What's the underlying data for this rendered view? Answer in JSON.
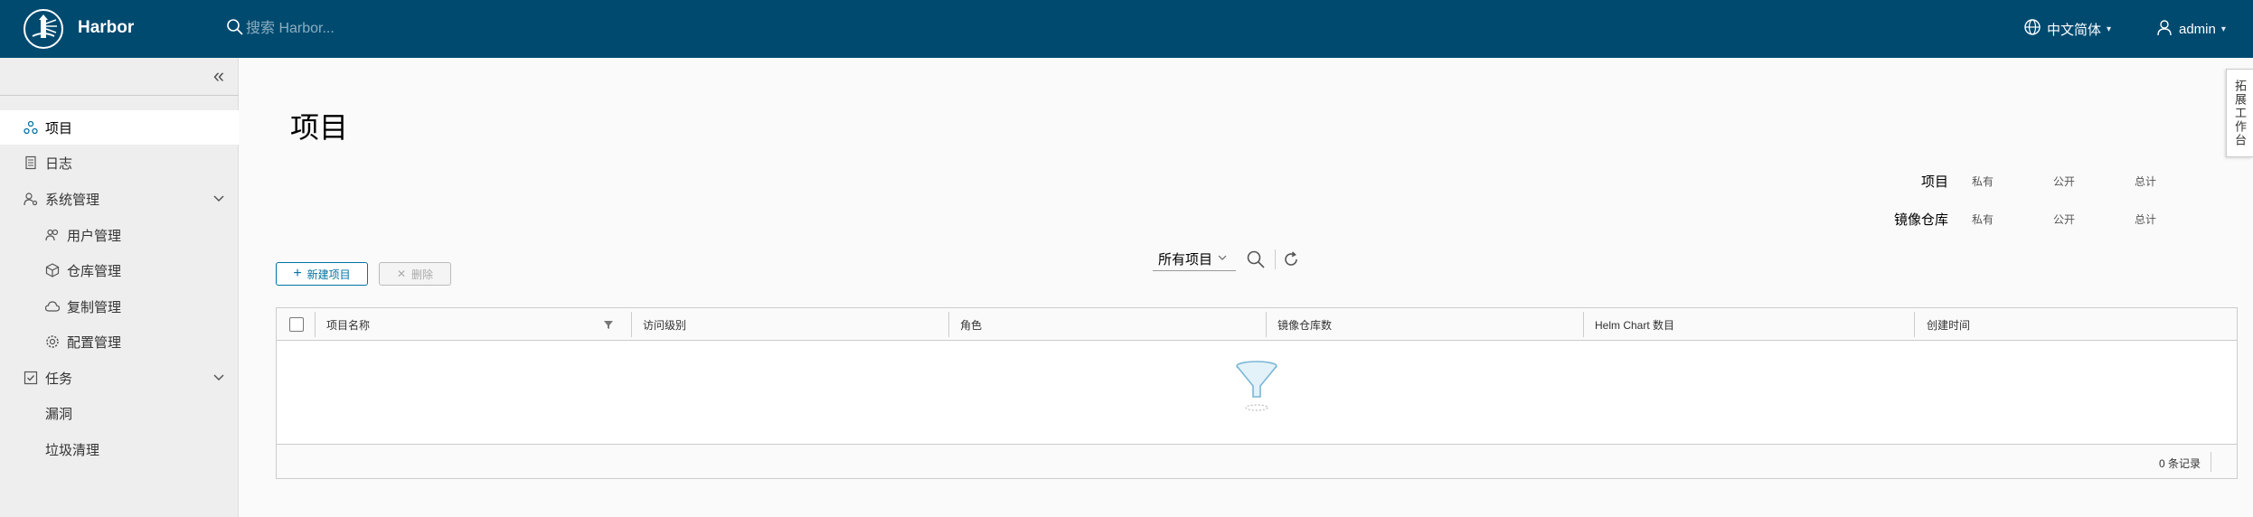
{
  "header": {
    "app_title": "Harbor",
    "search_placeholder": "搜索 Harbor...",
    "language": "中文简体",
    "user": "admin"
  },
  "sidebar": {
    "items": [
      {
        "label": "项目",
        "icon": "projects-icon",
        "active": true
      },
      {
        "label": "日志",
        "icon": "logs-icon"
      },
      {
        "label": "系统管理",
        "icon": "admin-icon",
        "expandable": true
      },
      {
        "label": "用户管理",
        "icon": "users-icon"
      },
      {
        "label": "仓库管理",
        "icon": "registry-icon"
      },
      {
        "label": "复制管理",
        "icon": "cloud-icon"
      },
      {
        "label": "配置管理",
        "icon": "gear-icon"
      },
      {
        "label": "任务",
        "icon": "tasks-icon",
        "expandable": true
      },
      {
        "label": "漏洞"
      },
      {
        "label": "垃圾清理"
      }
    ]
  },
  "main": {
    "title": "项目",
    "stats": {
      "projects_label": "项目",
      "repos_label": "镜像仓库",
      "private": "私有",
      "public": "公开",
      "total": "总计"
    },
    "toolbar": {
      "new_label": "新建项目",
      "delete_label": "删除",
      "filter_value": "所有项目"
    },
    "table": {
      "columns": [
        "项目名称",
        "访问级别",
        "角色",
        "镜像仓库数",
        "Helm Chart 数目",
        "创建时间"
      ],
      "footer": "0 条记录"
    }
  },
  "side_tab": "拓展工作台",
  "colors": {
    "header_bg": "#004a70",
    "accent": "#0072a3"
  }
}
